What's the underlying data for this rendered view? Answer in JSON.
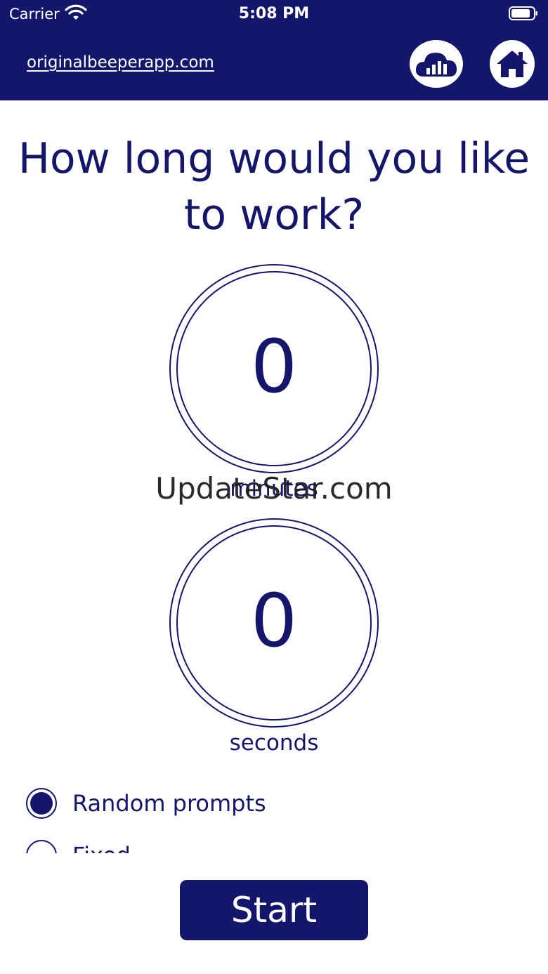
{
  "status_bar": {
    "carrier": "Carrier",
    "time": "5:08 PM"
  },
  "header": {
    "site_link": "originalbeeperapp.com",
    "stats_icon": "cloud-chart-icon",
    "home_icon": "home-icon"
  },
  "question": "How long would you like to work?",
  "minutes": {
    "value": "0",
    "unit": "minutes"
  },
  "seconds": {
    "value": "0",
    "unit": "seconds"
  },
  "watermark": "UpdateStar.com",
  "options": [
    {
      "label": "Random prompts",
      "selected": true
    },
    {
      "label": "Fixed",
      "selected": false
    }
  ],
  "start_label": "Start",
  "colors": {
    "primary": "#13166b",
    "background": "#ffffff"
  }
}
